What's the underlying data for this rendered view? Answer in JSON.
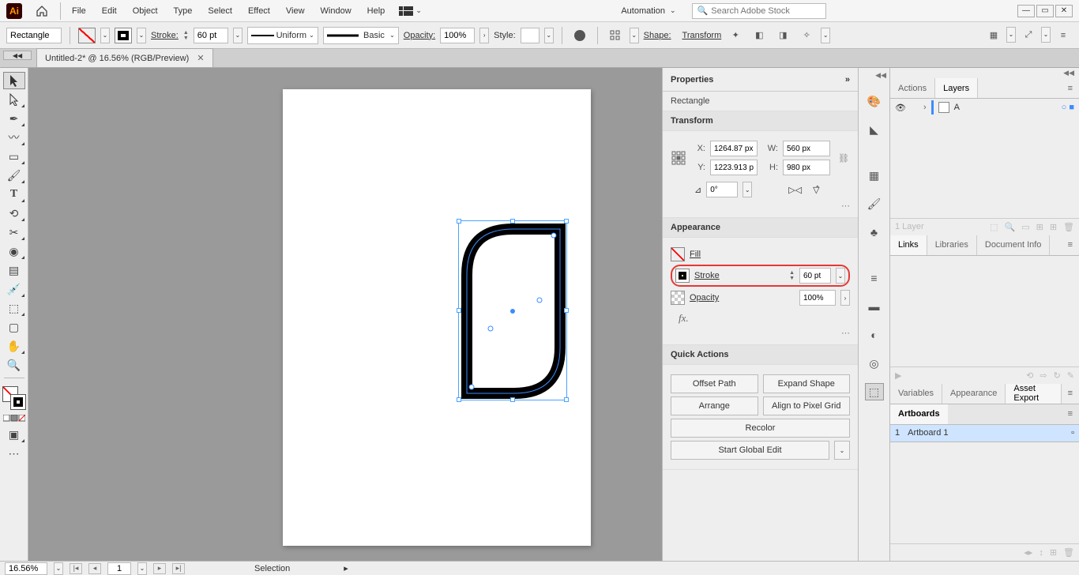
{
  "menu": {
    "items": [
      "File",
      "Edit",
      "Object",
      "Type",
      "Select",
      "Effect",
      "View",
      "Window",
      "Help"
    ],
    "automation": "Automation",
    "search_ph": "Search Adobe Stock"
  },
  "control": {
    "shape": "Rectangle",
    "stroke_label": "Stroke:",
    "stroke_val": "60 pt",
    "profile": "Uniform",
    "brush": "Basic",
    "opacity_label": "Opacity:",
    "opacity_val": "100%",
    "style_label": "Style:",
    "shape_label": "Shape:",
    "transform_label": "Transform"
  },
  "doc": {
    "tab": "Untitled-2* @ 16.56% (RGB/Preview)"
  },
  "properties": {
    "title": "Properties",
    "obj": "Rectangle",
    "transform_hdr": "Transform",
    "x_lbl": "X:",
    "x": "1264.87 px",
    "y_lbl": "Y:",
    "y": "1223.913 p",
    "w_lbl": "W:",
    "w": "560 px",
    "h_lbl": "H:",
    "h": "980 px",
    "rot": "0°",
    "appearance_hdr": "Appearance",
    "fill": "Fill",
    "stroke": "Stroke",
    "stroke_val": "60 pt",
    "opacity": "Opacity",
    "opacity_val": "100%",
    "qa_hdr": "Quick Actions",
    "offset": "Offset Path",
    "expand": "Expand Shape",
    "arrange": "Arrange",
    "align": "Align to Pixel Grid",
    "recolor": "Recolor",
    "start_edit": "Start Global Edit"
  },
  "right": {
    "actions": "Actions",
    "layers": "Layers",
    "layer_name": "A",
    "layer_count": "1 Layer",
    "links": "Links",
    "libraries": "Libraries",
    "docinfo": "Document Info",
    "variables": "Variables",
    "appearance": "Appearance",
    "asset_export": "Asset Export",
    "artboards": "Artboards",
    "ab1_num": "1",
    "ab1_name": "Artboard 1"
  },
  "status": {
    "zoom": "16.56%",
    "page": "1",
    "tool": "Selection"
  }
}
